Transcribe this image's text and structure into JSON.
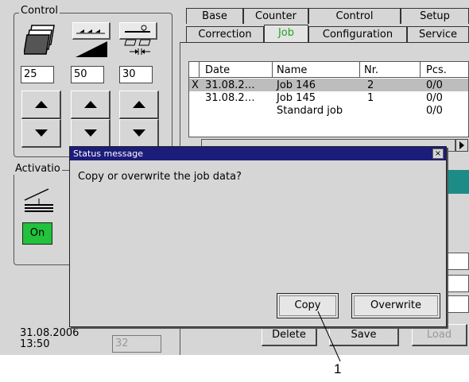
{
  "control_panel": {
    "title": "Control",
    "values": [
      "25",
      "50",
      "30"
    ]
  },
  "activation_panel": {
    "title": "Activatio",
    "on_label": "On"
  },
  "tabs": {
    "row1": [
      "Base",
      "Counter",
      "Control",
      "Setup"
    ],
    "row2": [
      "Correction",
      "Job",
      "Configuration",
      "Service"
    ],
    "active": "Job"
  },
  "job_table": {
    "columns": [
      "Date",
      "Name",
      "Nr.",
      "Pcs."
    ],
    "rows": [
      {
        "marker": "X",
        "date": "31.08.2…",
        "name": "Job 146",
        "nr": "2",
        "pcs": "0/0"
      },
      {
        "marker": "",
        "date": "31.08.2…",
        "name": "Job 145",
        "nr": "1",
        "pcs": "0/0"
      },
      {
        "marker": "",
        "date": "",
        "name": "Standard job",
        "nr": "",
        "pcs": "0/0"
      }
    ]
  },
  "footer": {
    "date": "31.08.2006",
    "time": "13:50",
    "counter": "32",
    "buttons": {
      "delete": "Delete",
      "save": "Save",
      "load": "Load"
    }
  },
  "dialog": {
    "title": "Status message",
    "close_glyph": "×",
    "message": "Copy or overwrite the job data?",
    "copy_label": "Copy",
    "overwrite_label": "Overwrite"
  },
  "callout": {
    "number": "1"
  },
  "colors": {
    "active_tab_text": "#23a323",
    "on_button": "#22c23c",
    "dialog_titlebar": "#1c1c7a",
    "teal_accent": "#1e8c86"
  }
}
